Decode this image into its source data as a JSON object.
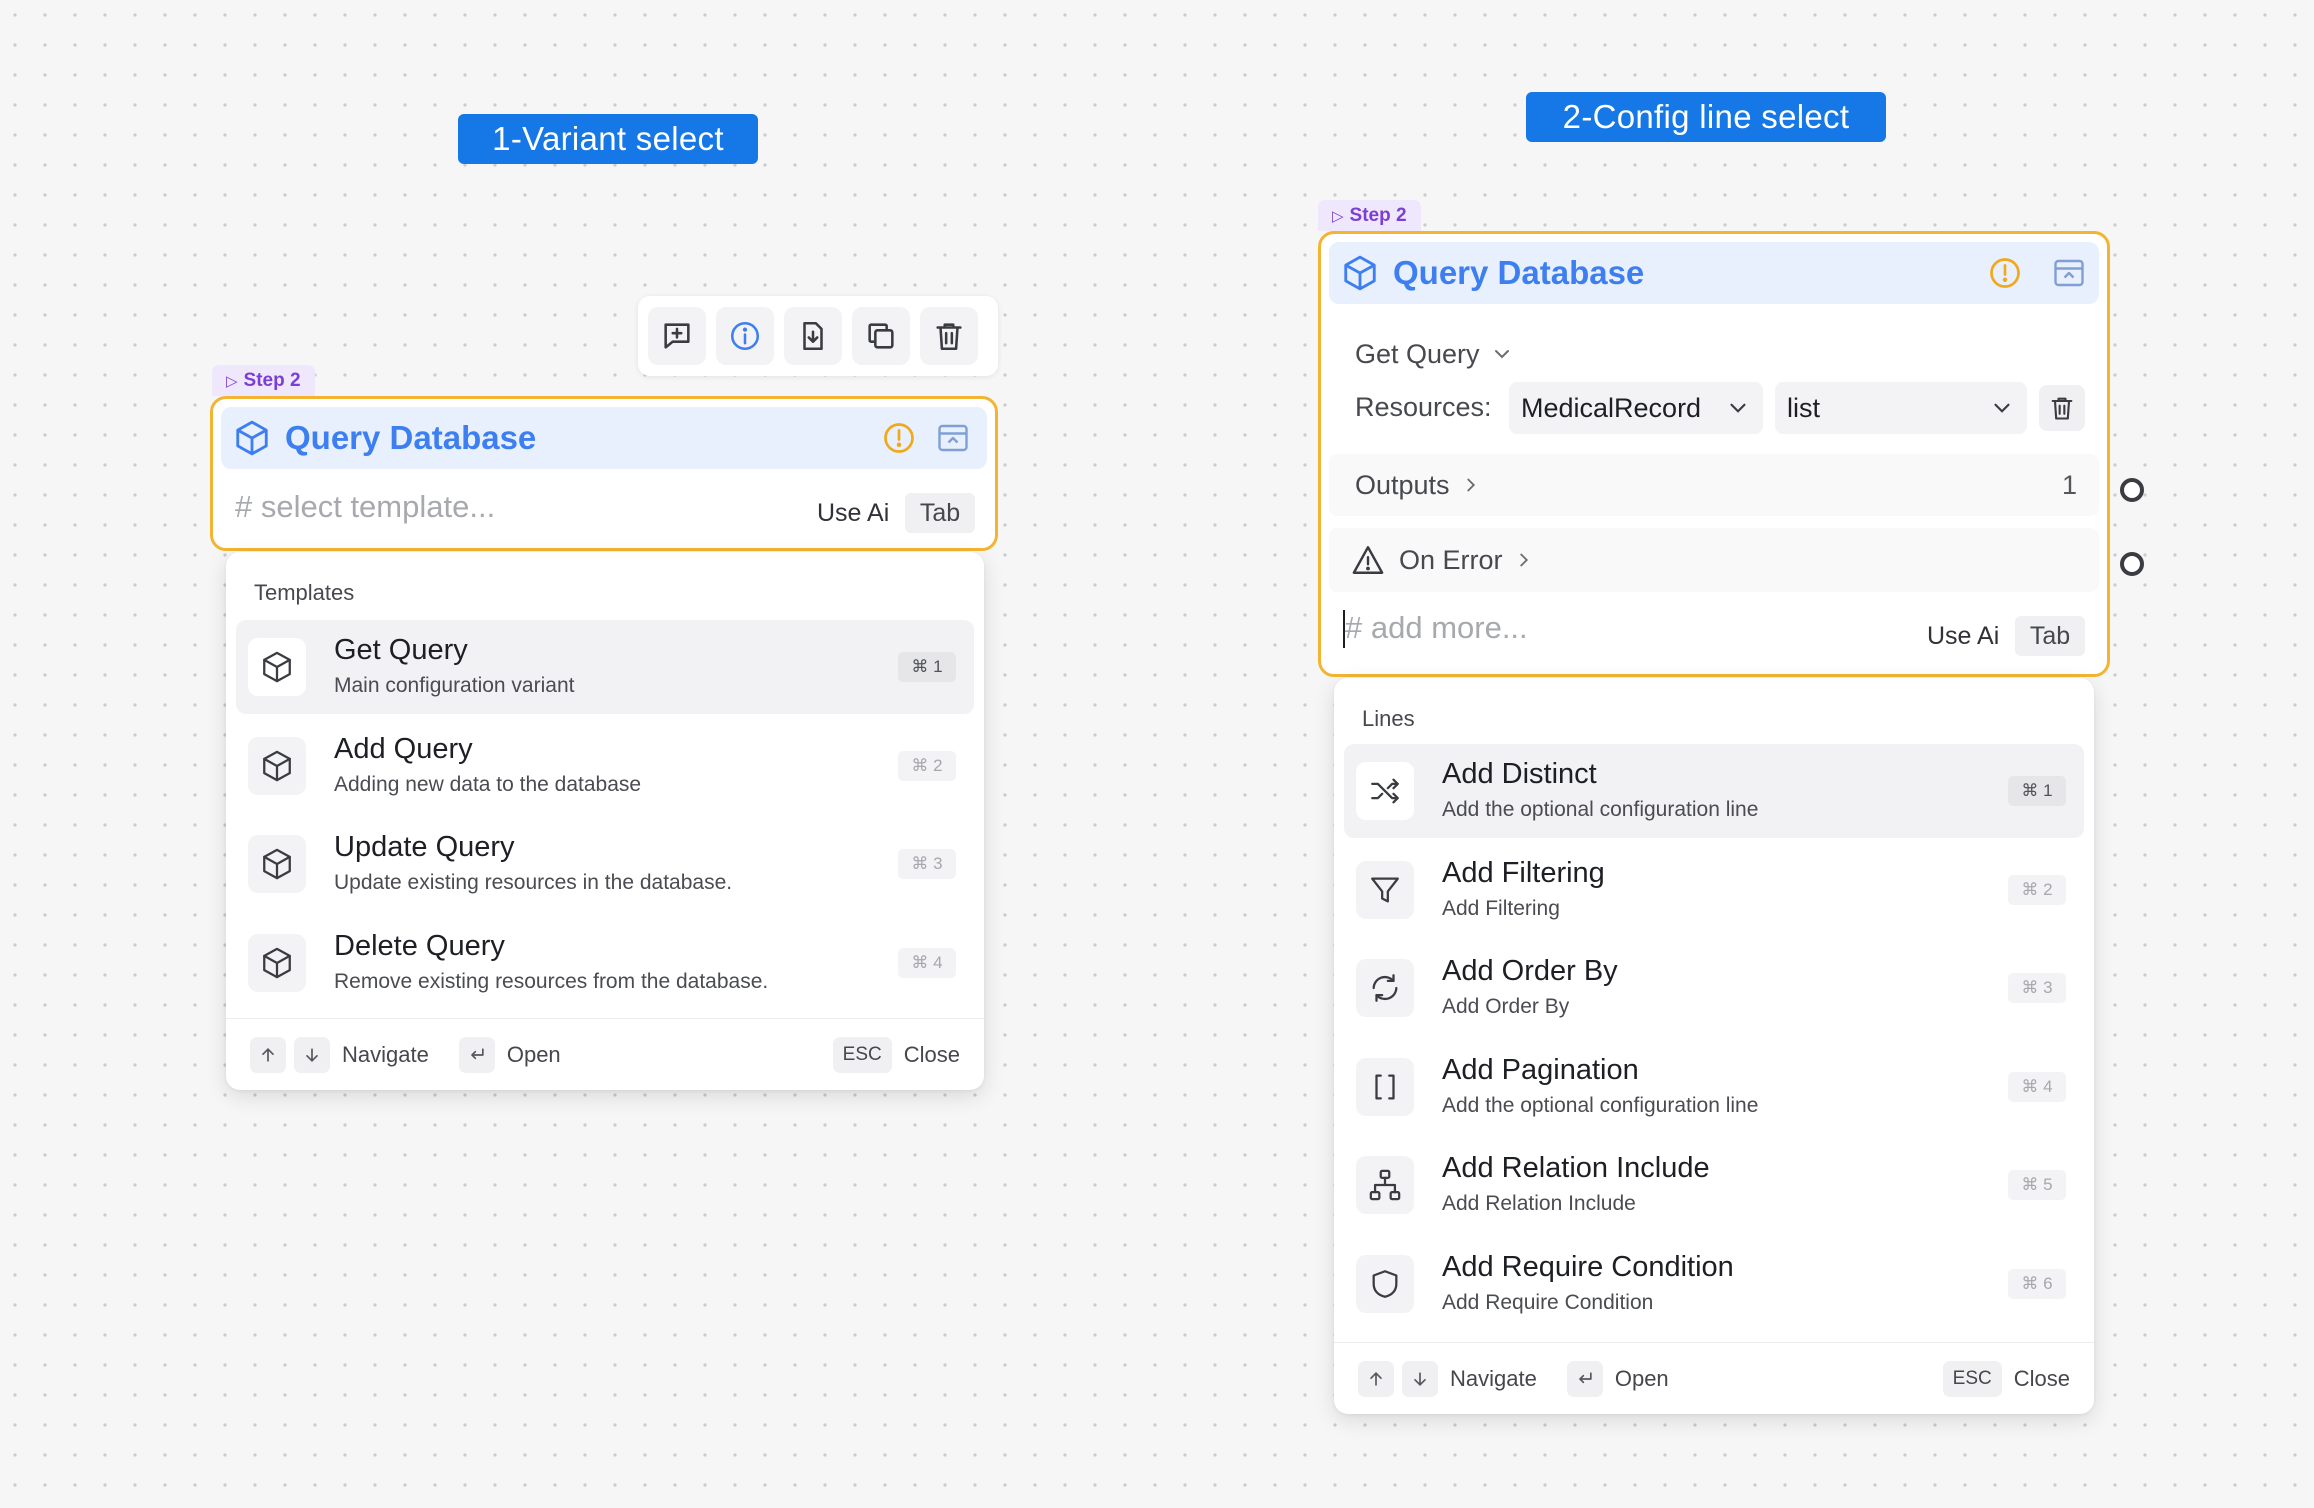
{
  "labels": {
    "left": "1-Variant select",
    "right": "2-Config line select"
  },
  "left_node": {
    "step": "Step 2",
    "title": "Query Database",
    "placeholder": "# select template...",
    "use_ai": "Use Ai",
    "tab_key": "Tab",
    "toolbar_icons": [
      "add-comment-icon",
      "info-icon",
      "download-icon",
      "copy-icon",
      "trash-icon"
    ],
    "menu": {
      "section": "Templates",
      "items": [
        {
          "title": "Get Query",
          "desc": "Main configuration variant",
          "kbd": "⌘ 1",
          "icon": "cube-icon"
        },
        {
          "title": "Add Query",
          "desc": "Adding new data to the database",
          "kbd": "⌘ 2",
          "icon": "cube-icon"
        },
        {
          "title": "Update Query",
          "desc": "Update existing resources in the database.",
          "kbd": "⌘ 3",
          "icon": "cube-icon"
        },
        {
          "title": "Delete Query",
          "desc": "Remove existing resources from the database.",
          "kbd": "⌘ 4",
          "icon": "cube-icon"
        }
      ],
      "footer": {
        "navigate": "Navigate",
        "open": "Open",
        "esc": "ESC",
        "close": "Close"
      }
    }
  },
  "right_node": {
    "step": "Step 2",
    "title": "Query Database",
    "variant": "Get Query",
    "resources_label": "Resources:",
    "resource_value": "MedicalRecord",
    "operation_value": "list",
    "outputs_label": "Outputs",
    "outputs_count": "1",
    "on_error_label": "On Error",
    "placeholder": "# add more...",
    "use_ai": "Use Ai",
    "tab_key": "Tab",
    "menu": {
      "section": "Lines",
      "items": [
        {
          "title": "Add Distinct",
          "desc": "Add the optional configuration line",
          "kbd": "⌘ 1",
          "icon": "shuffle-icon"
        },
        {
          "title": "Add Filtering",
          "desc": "Add Filtering",
          "kbd": "⌘ 2",
          "icon": "filter-icon"
        },
        {
          "title": "Add Order By",
          "desc": "Add Order By",
          "kbd": "⌘ 3",
          "icon": "refresh-icon"
        },
        {
          "title": "Add Pagination",
          "desc": "Add the optional configuration line",
          "kbd": "⌘ 4",
          "icon": "brackets-icon"
        },
        {
          "title": "Add Relation Include",
          "desc": "Add Relation Include",
          "kbd": "⌘ 5",
          "icon": "hierarchy-icon"
        },
        {
          "title": "Add Require Condition",
          "desc": "Add Require Condition",
          "kbd": "⌘ 6",
          "icon": "shield-icon"
        }
      ],
      "footer": {
        "navigate": "Navigate",
        "open": "Open",
        "esc": "ESC",
        "close": "Close"
      }
    }
  },
  "colors": {
    "label_bg": "#1677e6",
    "node_border": "#f3b531",
    "title": "#3d7ff0",
    "step_bg": "#efe7fb",
    "step_text": "#7c3fd4"
  }
}
